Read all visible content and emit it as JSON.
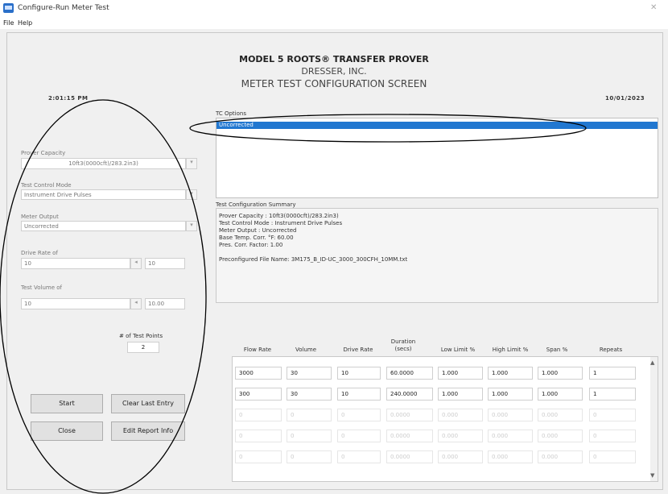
{
  "window": {
    "title": "Configure-Run Meter Test"
  },
  "menu": [
    "File",
    "Help"
  ],
  "header": {
    "line1": "MODEL 5 ROOTS® TRANSFER PROVER",
    "line2": "DRESSER, INC.",
    "line3": "METER TEST CONFIGURATION SCREEN",
    "time": "2:01:15 PM",
    "date": "10/01/2023"
  },
  "left_panel": {
    "prover_capacity": {
      "label": "Prover Capacity",
      "value": "10ft3(0000cft)/283.2in3)"
    },
    "test_control_mode": {
      "label": "Test Control Mode",
      "value": "Instrument Drive Pulses"
    },
    "meter_output": {
      "label": "Meter Output",
      "value": "Uncorrected"
    },
    "drive_rate": {
      "label": "Drive Rate of",
      "value": "10",
      "value2": "10"
    },
    "test_volume": {
      "label": "Test Volume of",
      "value": "10",
      "value2": "10.00"
    },
    "num_test_points": {
      "label": "# of Test Points",
      "value": "2"
    },
    "buttons": {
      "start": "Start",
      "clear_last": "Clear Last Entry",
      "close": "Close",
      "edit_report": "Edit Report Info"
    }
  },
  "tc_options": {
    "label": "TC Options",
    "selected": "Uncorrected"
  },
  "summary": {
    "label": "Test Configuration Summary",
    "lines": [
      "Prover Capacity : 10ft3(0000cft)/283.2in3)",
      "Test Control Mode : Instrument Drive Pulses",
      "Meter Output : Uncorrected",
      "Base Temp. Corr. °F: 60.00",
      "Pres. Corr. Factor: 1.00"
    ],
    "file_line": "Preconfigured File Name: 3M175_B_ID-UC_3000_300CFH_10MM.txt"
  },
  "grid": {
    "headers": [
      "Flow Rate",
      "Volume",
      "Drive Rate",
      "Duration (secs)",
      "Low Limit %",
      "High Limit %",
      "Span %",
      "Repeats"
    ],
    "rows": [
      [
        "3000",
        "30",
        "10",
        "60.0000",
        "1.000",
        "1.000",
        "1.000",
        "1"
      ],
      [
        "300",
        "30",
        "10",
        "240.0000",
        "1.000",
        "1.000",
        "1.000",
        "1"
      ],
      [
        "0",
        "0",
        "0",
        "0.0000",
        "0.000",
        "0.000",
        "0.000",
        "0"
      ],
      [
        "0",
        "0",
        "0",
        "0.0000",
        "0.000",
        "0.000",
        "0.000",
        "0"
      ],
      [
        "0",
        "0",
        "0",
        "0.0000",
        "0.000",
        "0.000",
        "0.000",
        "0"
      ]
    ]
  }
}
